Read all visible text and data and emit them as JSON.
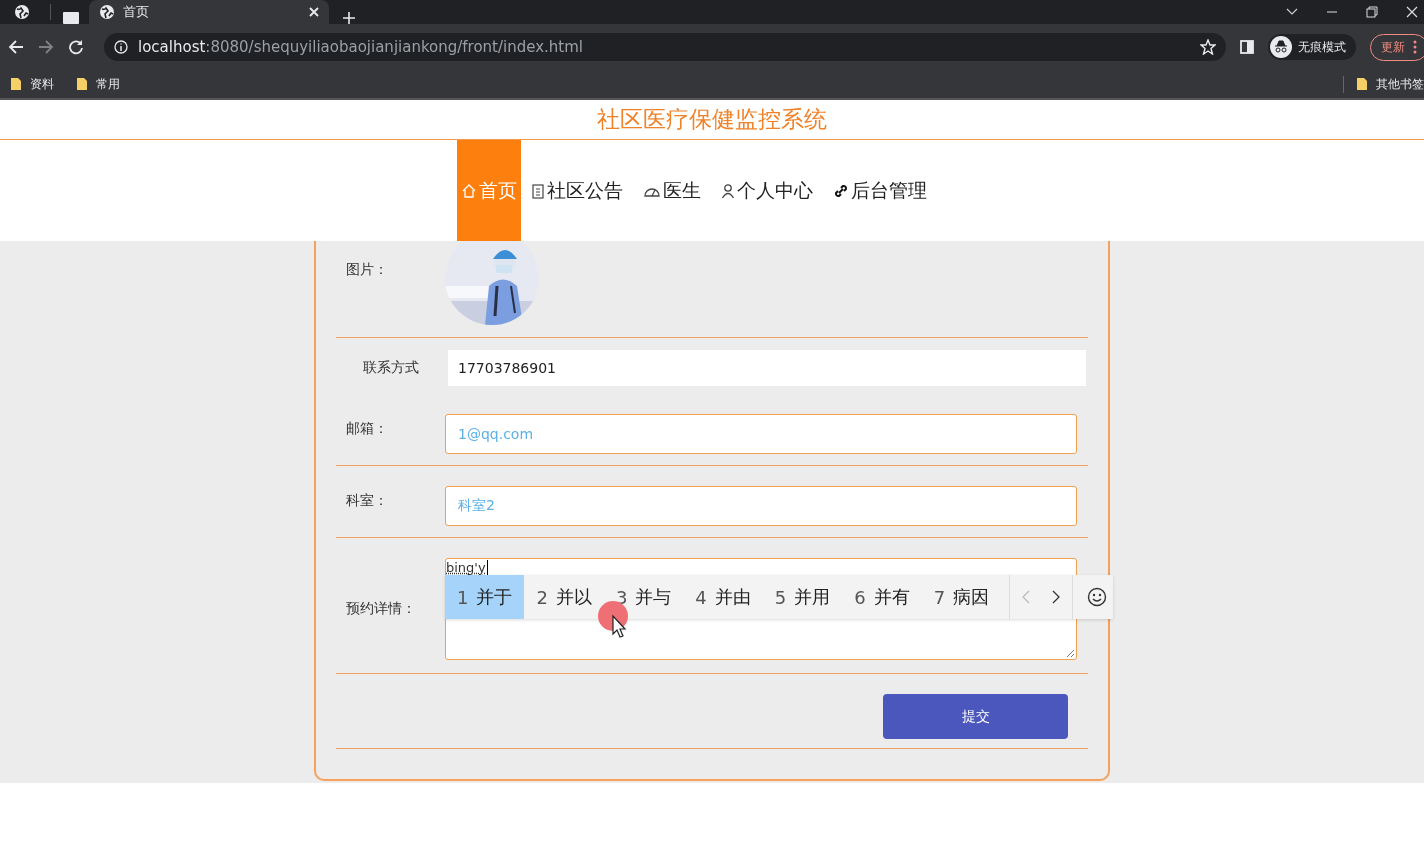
{
  "browser": {
    "tabs": [
      {
        "title": "首页",
        "selected": true
      }
    ],
    "address": {
      "host": "localhost",
      "path": ":8080/shequyiliaobaojianjiankong/front/index.html"
    },
    "incognito_label": "无痕模式",
    "update_button": "更新",
    "bookmarks": [
      "资料",
      "常用"
    ],
    "other_bookmarks": "其他书签"
  },
  "site_title": "社区医疗保健监控系统",
  "nav": [
    {
      "label": "首页",
      "kind": "home",
      "selected": true
    },
    {
      "label": "社区公告",
      "kind": "notice",
      "selected": false
    },
    {
      "label": "医生",
      "kind": "gauge",
      "selected": false
    },
    {
      "label": "个人中心",
      "kind": "user",
      "selected": false
    },
    {
      "label": "后台管理",
      "kind": "link",
      "selected": false
    }
  ],
  "form": {
    "sections": [
      [
        {
          "label": "图片："
        }
      ],
      [
        {
          "kind": "plain",
          "label": "联系方式",
          "value": "17703786901"
        },
        {
          "kind": "outlined",
          "label": "邮箱：",
          "value": "1@qq.com"
        }
      ],
      [
        {
          "kind": "outlined",
          "label": "科室：",
          "value": "科室2"
        }
      ],
      [
        {
          "kind": "textarea",
          "label": "预约详情：",
          "value": "bing'y",
          "ime": {
            "candidates": [
              {
                "number": "1",
                "text": "并于",
                "selected": true
              },
              {
                "number": "2",
                "text": "并以",
                "selected": false
              },
              {
                "number": "3",
                "text": "并与",
                "selected": false
              },
              {
                "number": "4",
                "text": "并由",
                "selected": false
              },
              {
                "number": "5",
                "text": "并用",
                "selected": false
              },
              {
                "number": "6",
                "text": "并有",
                "selected": false
              },
              {
                "number": "7",
                "text": "病因",
                "selected": false
              }
            ]
          }
        }
      ],
      [
        {
          "kind": "submit",
          "label": "提交"
        }
      ]
    ]
  }
}
